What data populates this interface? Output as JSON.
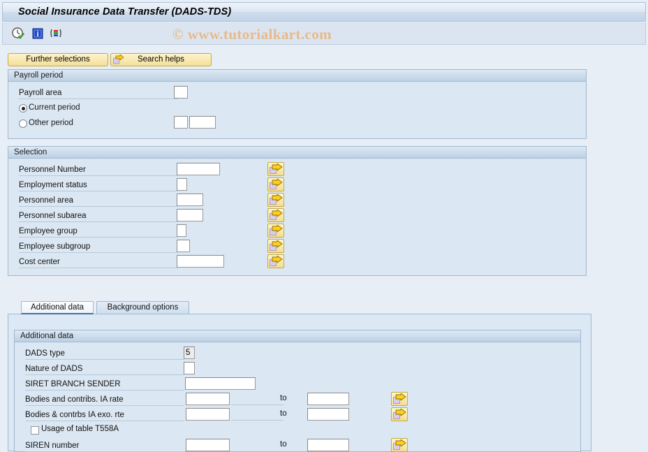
{
  "window": {
    "title": "Social Insurance Data Transfer (DADS-TDS)"
  },
  "watermark": "© www.tutorialkart.com",
  "toolbar": {
    "icons": [
      {
        "name": "execute-clock-icon",
        "title": "Execute"
      },
      {
        "name": "info-icon",
        "title": "Information"
      },
      {
        "name": "variant-icon",
        "title": "Get Variant"
      }
    ]
  },
  "action_buttons": {
    "further_selections": "Further selections",
    "search_helps": "Search helps"
  },
  "payroll_period": {
    "title": "Payroll period",
    "payroll_area_label": "Payroll area",
    "payroll_area_value": "",
    "current_period_label": "Current period",
    "current_period_selected": true,
    "other_period_label": "Other period",
    "other_period_selected": false,
    "other_period_value_1": "",
    "other_period_value_2": ""
  },
  "selection": {
    "title": "Selection",
    "rows": [
      {
        "label": "Personnel Number",
        "value": "",
        "input_width": 62,
        "has_arrow": true
      },
      {
        "label": "Employment status",
        "value": "",
        "input_width": 15,
        "has_arrow": true
      },
      {
        "label": "Personnel area",
        "value": "",
        "input_width": 38,
        "has_arrow": true
      },
      {
        "label": "Personnel subarea",
        "value": "",
        "input_width": 38,
        "has_arrow": true
      },
      {
        "label": "Employee group",
        "value": "",
        "input_width": 14,
        "has_arrow": true
      },
      {
        "label": "Employee subgroup",
        "value": "",
        "input_width": 19,
        "has_arrow": true
      },
      {
        "label": "Cost center",
        "value": "",
        "input_width": 68,
        "has_arrow": true
      }
    ]
  },
  "tabs": [
    {
      "label": "Additional data",
      "active": true
    },
    {
      "label": "Background options",
      "active": false
    }
  ],
  "additional_data": {
    "title": "Additional data",
    "dads_type_label": "DADS type",
    "dads_type_value": "5",
    "nature_label": "Nature of DADS",
    "nature_value": "",
    "siret_label": "SIRET BRANCH SENDER",
    "siret_value": "",
    "to_label": "to",
    "range_rows": [
      {
        "label": "Bodies and contribs. IA rate",
        "from": "",
        "to": ""
      },
      {
        "label": "Bodies & contrbs IA exo. rte",
        "from": "",
        "to": ""
      }
    ],
    "usage_t558a_label": "Usage of table T558A",
    "usage_t558a_checked": false,
    "siren_label": "SIREN number",
    "siren_from": "",
    "siren_to": ""
  },
  "colors": {
    "background": "#e8eef6",
    "group_fill": "#dbe7f2",
    "group_border": "#9fb8d0",
    "button_yellow": "#f6e6a8",
    "accent_tab": "#3f6fa5",
    "watermark": "#e8b98b"
  }
}
